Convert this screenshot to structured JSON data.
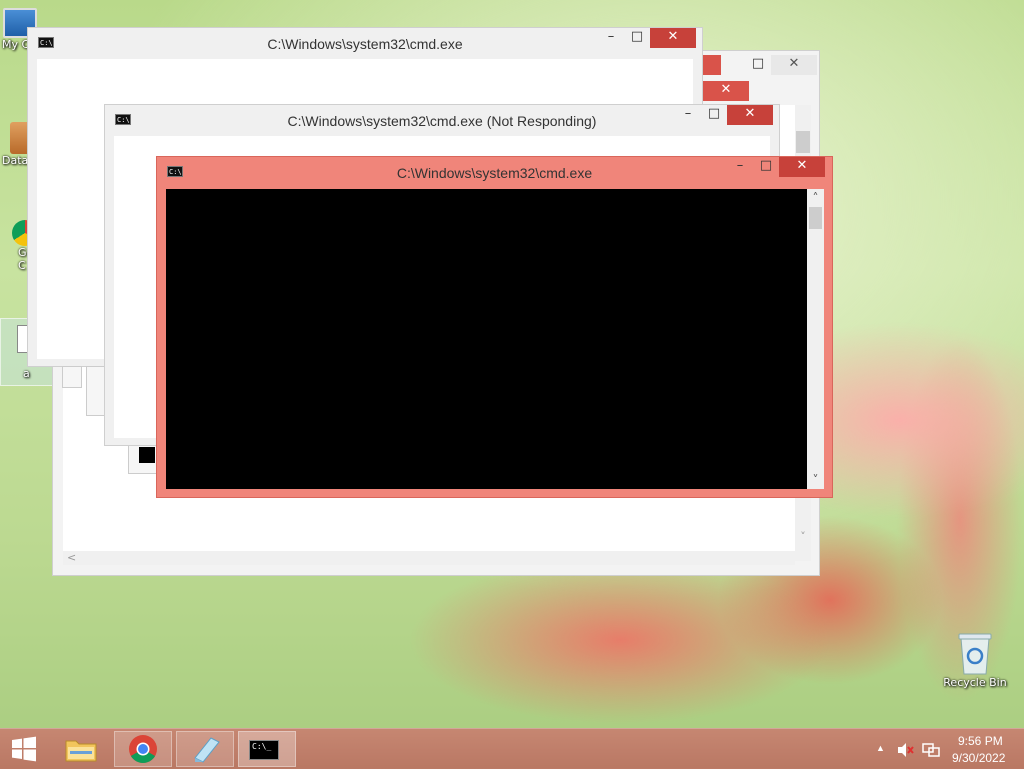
{
  "desktop": {
    "icons": [
      {
        "label": "My C",
        "icon": "computer-icon"
      },
      {
        "label": "Data",
        "icon": "shortcut-icon"
      },
      {
        "label": "G\nC",
        "icon": "chrome-shortcut-icon"
      },
      {
        "label": "a",
        "icon": "document-icon"
      }
    ],
    "recycle_bin_label": "Recycle Bin"
  },
  "windows": {
    "back": {
      "title": "C:\\Windows\\system32\\cmd.exe"
    },
    "middle": {
      "title": "C:\\Windows\\system32\\cmd.exe (Not Responding)"
    },
    "front": {
      "title": "C:\\Windows\\system32\\cmd.exe"
    },
    "controls": {
      "minimize": "–",
      "maximize": "□",
      "close": "✕"
    },
    "scroll_up": "˄",
    "scroll_down": "˅",
    "scroll_left": "<"
  },
  "taskbar": {
    "items": [
      {
        "name": "start",
        "icon": "windows-logo-icon"
      },
      {
        "name": "file-explorer",
        "icon": "folder-icon"
      },
      {
        "name": "chrome",
        "icon": "chrome-icon"
      },
      {
        "name": "notepad",
        "icon": "notepad-icon"
      },
      {
        "name": "cmd",
        "icon": "cmd-icon",
        "glyph": "C:\\_"
      }
    ],
    "tray": {
      "show_hidden_glyph": "▲",
      "time": "9:56 PM",
      "date": "9/30/2022"
    }
  },
  "colors": {
    "active_frame": "#f0857a",
    "close_button": "#c7413a",
    "console_bg": "#000000",
    "taskbar": "#c08272"
  }
}
